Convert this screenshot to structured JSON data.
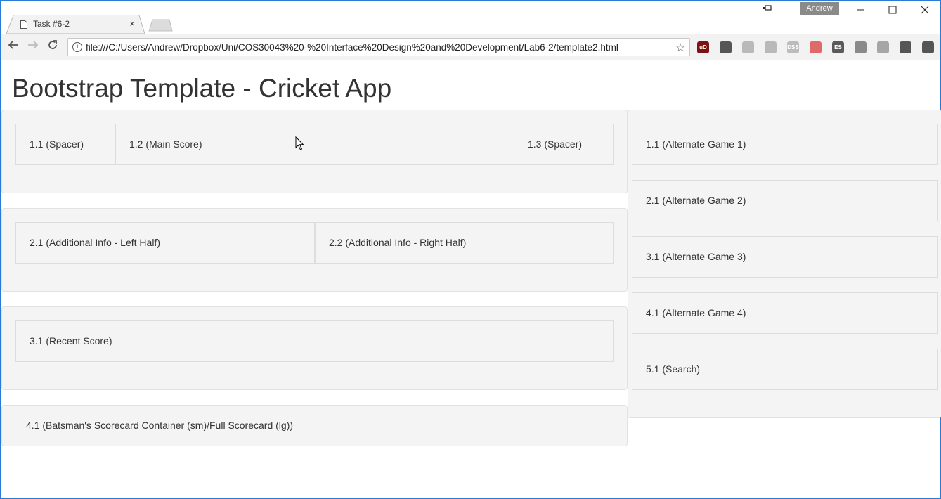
{
  "browser": {
    "tab_title": "Task #6-2",
    "tab_close": "×",
    "profile_name": "Andrew",
    "url": "file:///C:/Users/Andrew/Dropbox/Uni/COS30043%20-%20Interface%20Design%20and%20Development/Lab6-2/template2.html",
    "info_glyph": "i",
    "extensions": [
      {
        "name": "ublock-icon",
        "label": "uD",
        "color": "#7d1212"
      },
      {
        "name": "mail-icon",
        "label": "",
        "color": "#555555"
      },
      {
        "name": "play-icon",
        "label": "",
        "color": "#b9b9b9"
      },
      {
        "name": "drive-icon",
        "label": "",
        "color": "#b9b9b9"
      },
      {
        "name": "dss-icon",
        "label": "DSS",
        "color": "#bcbcbc"
      },
      {
        "name": "calendar-icon",
        "label": "",
        "color": "#e06a6a"
      },
      {
        "name": "es-icon",
        "label": "ES",
        "color": "#5a5a5a"
      },
      {
        "name": "clock-icon",
        "label": "",
        "color": "#8a8a8a"
      },
      {
        "name": "angular-icon",
        "label": "",
        "color": "#a6a6a6"
      },
      {
        "name": "cast-icon",
        "label": "",
        "color": "#555555"
      },
      {
        "name": "menu-icon",
        "label": "",
        "color": "#555555"
      }
    ]
  },
  "page": {
    "title": "Bootstrap Template - Cricket App",
    "left": {
      "row1": [
        "1.1 (Spacer)",
        "1.2 (Main Score)",
        "1.3 (Spacer)"
      ],
      "row2": [
        "2.1 (Additional Info - Left Half)",
        "2.2 (Additional Info - Right Half)"
      ],
      "row3": [
        "3.1 (Recent Score)"
      ],
      "row4": [
        "4.1 (Batsman's Scorecard Container (sm)/Full Scorecard (lg))"
      ]
    },
    "right": [
      "1.1 (Alternate Game 1)",
      "2.1 (Alternate Game 2)",
      "3.1 (Alternate Game 3)",
      "4.1 (Alternate Game 4)",
      "5.1 (Search)"
    ]
  }
}
